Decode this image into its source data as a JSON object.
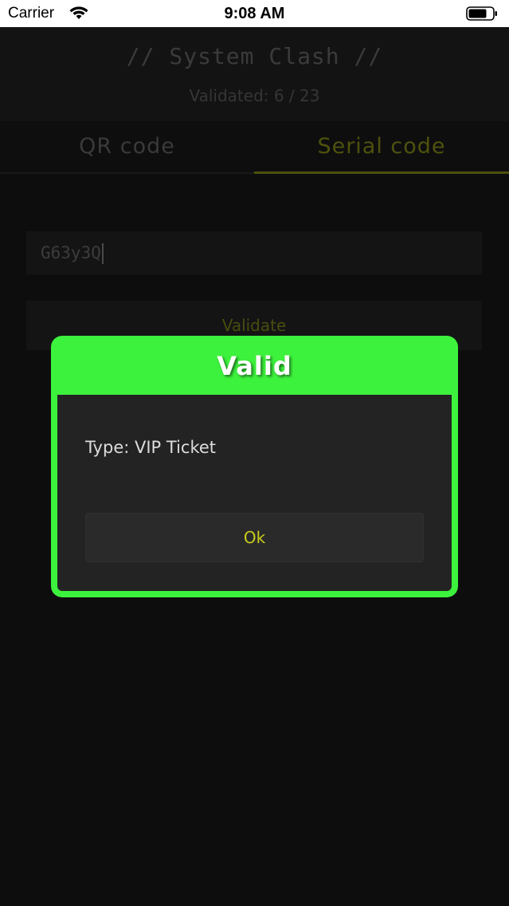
{
  "status_bar": {
    "carrier": "Carrier",
    "time": "9:08 AM",
    "wifi_icon": "wifi-icon",
    "battery_icon": "battery-icon"
  },
  "header": {
    "title": "// System Clash //",
    "validated": "Validated: 6 / 23"
  },
  "tabs": [
    {
      "label": "QR code",
      "active": false
    },
    {
      "label": "Serial code",
      "active": true
    }
  ],
  "form": {
    "serial_value": "G63y3Q",
    "validate_label": "Validate"
  },
  "modal": {
    "title": "Valid",
    "type_text": "Type: VIP Ticket",
    "ok_label": "Ok"
  },
  "colors": {
    "success": "#3df23d",
    "accent": "#c9cc1a",
    "background": "#0d0d0e"
  }
}
